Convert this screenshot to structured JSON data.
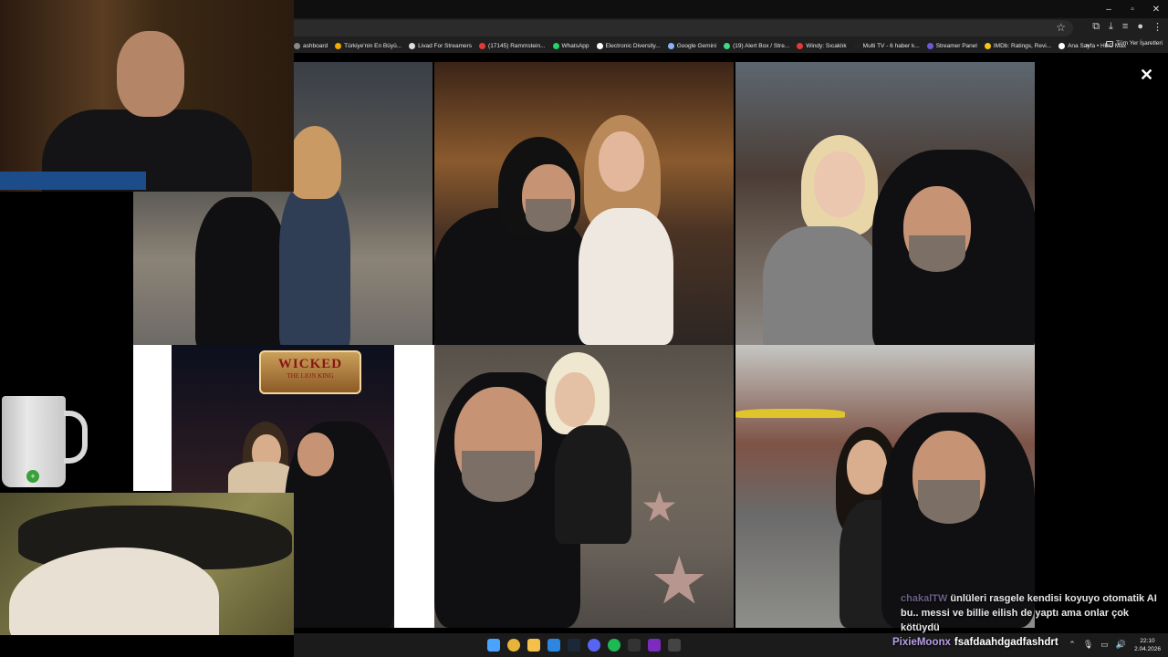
{
  "browser": {
    "bookmarks": [
      {
        "label": "ashboard",
        "color": "#888888"
      },
      {
        "label": "Türkiye'nin En Büyü...",
        "color": "#f2a900"
      },
      {
        "label": "Livad For Streamers",
        "color": "#dddddd"
      },
      {
        "label": "(17145) Rammstein...",
        "color": "#e53935"
      },
      {
        "label": "WhatsApp",
        "color": "#25d366"
      },
      {
        "label": "Electronic Diversity...",
        "color": "#ffffff"
      },
      {
        "label": "Google Gemini",
        "color": "#8ab4f8"
      },
      {
        "label": "(19) Alert Box / Stre...",
        "color": "#3ddc84"
      },
      {
        "label": "Windy: Sıcaklık",
        "color": "#e53935"
      },
      {
        "label": "Multi TV - 6 haber k...",
        "color": "#222222"
      },
      {
        "label": "Streamer Panel",
        "color": "#6b5bd6"
      },
      {
        "label": "IMDb: Ratings, Revi...",
        "color": "#f5c518"
      },
      {
        "label": "Ana Sayfa • HBO Max",
        "color": "#ffffff"
      }
    ],
    "more": "»",
    "folder_label": "Tüm Yer İşaretleri"
  },
  "viewer": {
    "close": "✕",
    "sign_title": "WICKED",
    "sign_sub": "THE LION KING"
  },
  "chat": {
    "line1_user": "chakalTW",
    "line1_msg": "ünlüleri rasgele kendisi koyuyo otomatik AI bu.. messi ve billie eilish de yaptı ama onlar çok kötüydü",
    "line2_user": "PixieMoonx",
    "line2_msg": "fsafdaahdgadfashdrt"
  },
  "taskbar": {
    "time": "22:10",
    "date": "2.04.2026",
    "icons": [
      "windows-icon",
      "chrome-icon",
      "explorer-icon",
      "edge-icon",
      "steam-icon",
      "discord-icon",
      "spotify-icon",
      "epic-icon",
      "next-icon",
      "obs-icon"
    ]
  },
  "mug_badge": "+"
}
